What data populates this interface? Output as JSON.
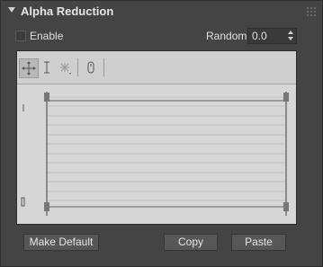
{
  "panel": {
    "title": "Alpha Reduction"
  },
  "enable": {
    "label": "Enable",
    "checked": false
  },
  "random": {
    "label": "Random",
    "value": "0.0"
  },
  "curve_editor": {
    "tools": [
      {
        "name": "move-tool-icon",
        "active": true
      },
      {
        "name": "scale-tool-icon",
        "active": false
      },
      {
        "name": "add-point-tool-icon",
        "active": false
      },
      {
        "name": "pan-tool-icon",
        "active": false
      }
    ]
  },
  "buttons": {
    "make_default": "Make Default",
    "copy": "Copy",
    "paste": "Paste"
  },
  "colors": {
    "panel_bg": "#444444",
    "graph_bg": "#d6d6d6",
    "button_bg": "#575757"
  }
}
